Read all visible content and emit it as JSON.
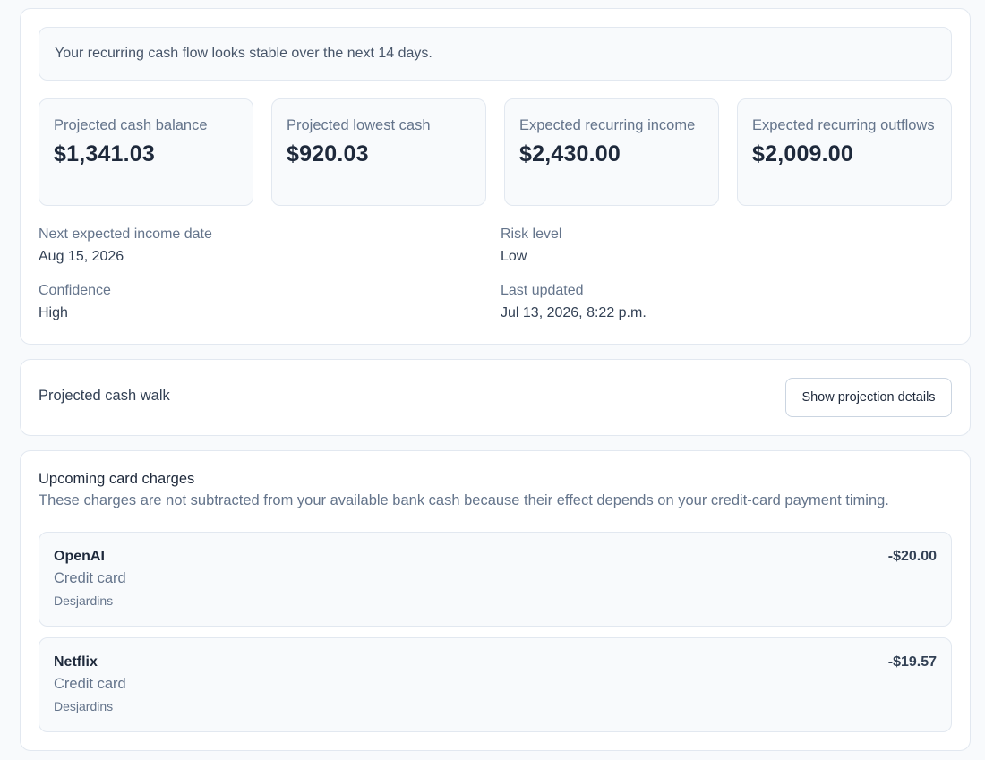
{
  "summary": {
    "banner": "Your recurring cash flow looks stable over the next 14 days.",
    "metrics": [
      {
        "label": "Projected cash balance",
        "value": "$1,341.03"
      },
      {
        "label": "Projected lowest cash",
        "value": "$920.03"
      },
      {
        "label": "Expected recurring income",
        "value": "$2,430.00"
      },
      {
        "label": "Expected recurring outflows",
        "value": "$2,009.00"
      }
    ],
    "details": {
      "next_income": {
        "label": "Next expected income date",
        "value": "Aug 15, 2026"
      },
      "risk": {
        "label": "Risk level",
        "value": "Low"
      },
      "confidence": {
        "label": "Confidence",
        "value": "High"
      },
      "updated": {
        "label": "Last updated",
        "value": "Jul 13, 2026, 8:22 p.m."
      }
    }
  },
  "walk": {
    "title": "Projected cash walk",
    "button_label": "Show projection details"
  },
  "charges": {
    "title": "Upcoming card charges",
    "subtitle": "These charges are not subtracted from your available bank cash because their effect depends on your credit-card payment timing.",
    "items": [
      {
        "name": "OpenAI",
        "method": "Credit card",
        "bank": "Desjardins",
        "amount": "-$20.00"
      },
      {
        "name": "Netflix",
        "method": "Credit card",
        "bank": "Desjardins",
        "amount": "-$19.57"
      }
    ]
  }
}
